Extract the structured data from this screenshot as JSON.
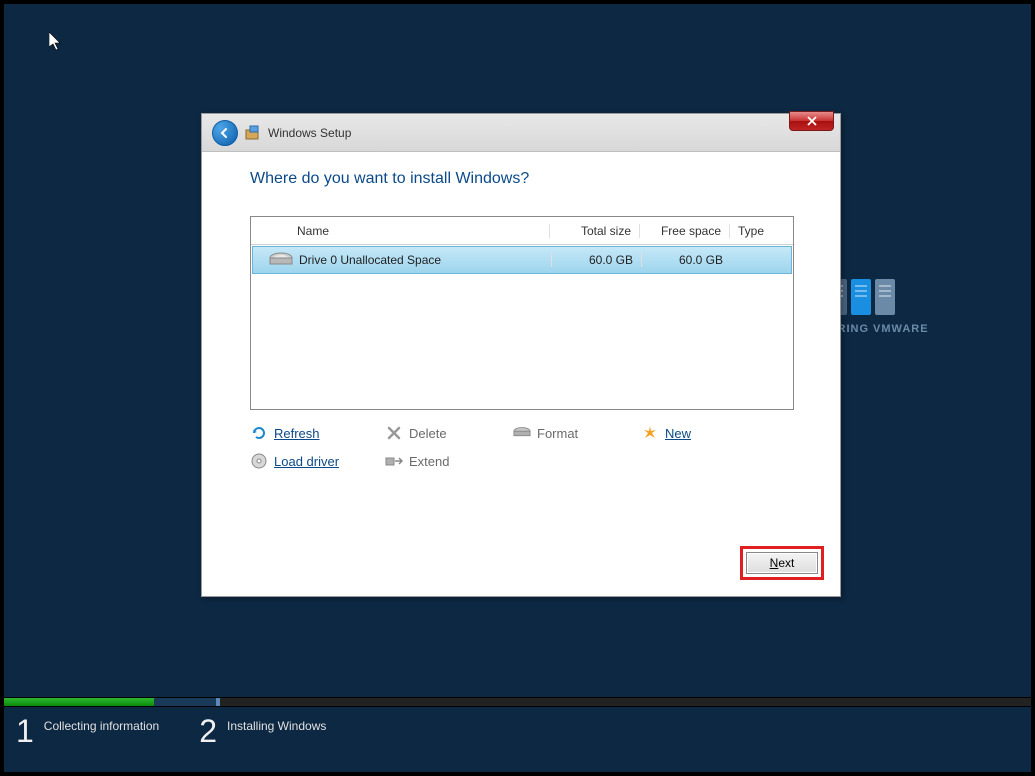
{
  "window": {
    "title": "Windows Setup",
    "heading": "Where do you want to install Windows?"
  },
  "table": {
    "headers": {
      "name": "Name",
      "total": "Total size",
      "free": "Free space",
      "type": "Type"
    },
    "rows": [
      {
        "name": "Drive 0 Unallocated Space",
        "total": "60.0 GB",
        "free": "60.0 GB",
        "type": ""
      }
    ]
  },
  "actions": {
    "refresh": "Refresh",
    "delete": "Delete",
    "format": "Format",
    "new": "New",
    "load_driver": "Load driver",
    "extend": "Extend"
  },
  "buttons": {
    "next": "Next"
  },
  "steps": {
    "s1_num": "1",
    "s1_label": "Collecting information",
    "s2_num": "2",
    "s2_label": "Installing Windows"
  },
  "watermark": "MASTERING VMWARE"
}
